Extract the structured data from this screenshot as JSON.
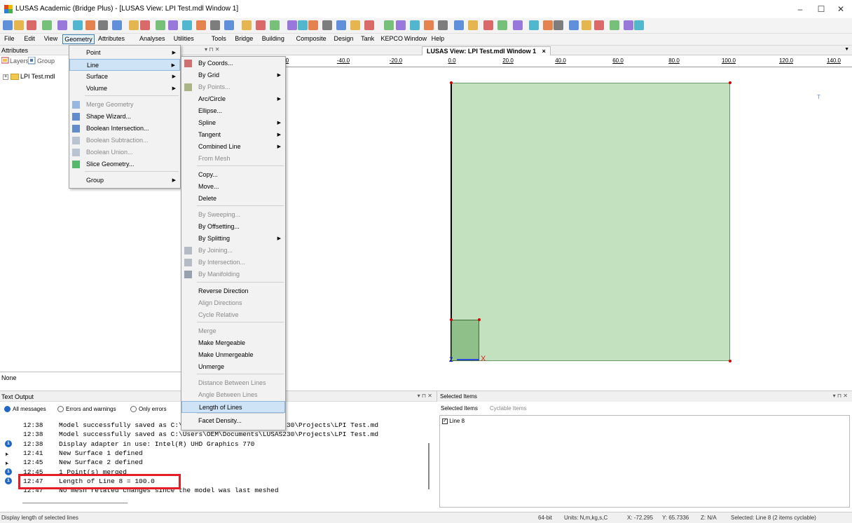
{
  "window": {
    "title": "LUSAS Academic (Bridge Plus) - [LUSAS View: LPI Test.mdl Window 1]",
    "minimize": "–",
    "maximize": "☐",
    "close": "✕"
  },
  "menubar": [
    "File",
    "Edit",
    "View",
    "Geometry",
    "Attributes",
    "Analyses",
    "Utilities",
    "Tools",
    "Bridge",
    "Building",
    "Composite",
    "Design",
    "Tank",
    "KEPCO",
    "Window",
    "Help"
  ],
  "left_panel": {
    "header": "Attributes",
    "tabs": [
      "Layers",
      "Group"
    ],
    "tree_item": "LPI Test.mdl",
    "status": "None"
  },
  "viewport": {
    "tab": "LUSAS View: LPI Test.mdl Window 1",
    "tab_close": "×",
    "pane_controls": "▾ ⊓ ✕",
    "ruler_labels": [
      "0",
      "-40.0",
      "-20.0",
      "0.0",
      "20.0",
      "40.0",
      "60.0",
      "80.0",
      "100.0",
      "120.0",
      "140.0"
    ],
    "triad_label": "T",
    "axis_z": "Z",
    "axis_x": "X"
  },
  "geometry_menu": [
    {
      "label": "Point",
      "submenu": true,
      "disabled": false
    },
    {
      "label": "Line",
      "submenu": true,
      "disabled": false,
      "highlighted": true
    },
    {
      "label": "Surface",
      "submenu": true,
      "disabled": false
    },
    {
      "label": "Volume",
      "submenu": true,
      "disabled": false
    },
    {
      "label": "Merge Geometry",
      "submenu": false,
      "disabled": true
    },
    {
      "label": "Shape Wizard...",
      "submenu": false,
      "disabled": false
    },
    {
      "label": "Boolean Intersection...",
      "submenu": false,
      "disabled": false
    },
    {
      "label": "Boolean Subtraction...",
      "submenu": false,
      "disabled": true
    },
    {
      "label": "Boolean Union...",
      "submenu": false,
      "disabled": true
    },
    {
      "label": "Slice Geometry...",
      "submenu": false,
      "disabled": false
    },
    {
      "label": "Group",
      "submenu": true,
      "disabled": false
    }
  ],
  "line_menu": [
    {
      "label": "By Coords...",
      "submenu": false,
      "disabled": false
    },
    {
      "label": "By Grid",
      "submenu": true,
      "disabled": false
    },
    {
      "label": "By Points...",
      "submenu": false,
      "disabled": true
    },
    {
      "label": "Arc/Circle",
      "submenu": true,
      "disabled": false
    },
    {
      "label": "Ellipse...",
      "submenu": false,
      "disabled": false
    },
    {
      "label": "Spline",
      "submenu": true,
      "disabled": false
    },
    {
      "label": "Tangent",
      "submenu": true,
      "disabled": false
    },
    {
      "label": "Combined Line",
      "submenu": true,
      "disabled": false
    },
    {
      "label": "From Mesh",
      "submenu": false,
      "disabled": true
    },
    {
      "label": "Copy...",
      "submenu": false,
      "disabled": false
    },
    {
      "label": "Move...",
      "submenu": false,
      "disabled": false
    },
    {
      "label": "Delete",
      "submenu": false,
      "disabled": false
    },
    {
      "label": "By Sweeping...",
      "submenu": false,
      "disabled": true
    },
    {
      "label": "By Offsetting...",
      "submenu": false,
      "disabled": false
    },
    {
      "label": "By Splitting",
      "submenu": true,
      "disabled": false
    },
    {
      "label": "By Joining...",
      "submenu": false,
      "disabled": true
    },
    {
      "label": "By Intersection...",
      "submenu": false,
      "disabled": true
    },
    {
      "label": "By Manifolding",
      "submenu": false,
      "disabled": true
    },
    {
      "label": "Reverse Direction",
      "submenu": false,
      "disabled": false
    },
    {
      "label": "Align Directions",
      "submenu": false,
      "disabled": true
    },
    {
      "label": "Cycle Relative",
      "submenu": false,
      "disabled": true
    },
    {
      "label": "Merge",
      "submenu": false,
      "disabled": true
    },
    {
      "label": "Make Mergeable",
      "submenu": false,
      "disabled": false
    },
    {
      "label": "Make Unmergeable",
      "submenu": false,
      "disabled": false
    },
    {
      "label": "Unmerge",
      "submenu": false,
      "disabled": false
    },
    {
      "label": "Distance Between Lines",
      "submenu": false,
      "disabled": true
    },
    {
      "label": "Angle Between Lines",
      "submenu": false,
      "disabled": true
    },
    {
      "label": "Length of Lines",
      "submenu": false,
      "disabled": false,
      "highlighted": true
    },
    {
      "label": "Facet Density...",
      "submenu": false,
      "disabled": false
    }
  ],
  "text_output": {
    "header": "Text Output",
    "pane_controls": "▾ ⊓ ✕",
    "filters": [
      "All messages",
      "Errors and warnings",
      "Only errors"
    ],
    "lines": [
      {
        "time": "12:38",
        "text": "Model successfully saved as C:\\Users\\OEM\\Documents\\LUSAS230\\Projects\\LPI Test.md",
        "icon": ""
      },
      {
        "time": "12:38",
        "text": "Model successfully saved as C:\\Users\\OEM\\Documents\\LUSAS230\\Projects\\LPI Test.md",
        "icon": ""
      },
      {
        "time": "12:38",
        "text": "Display adapter in use: Intel(R) UHD Graphics 770",
        "icon": "info"
      },
      {
        "time": "12:41",
        "text": "New Surface 1 defined",
        "icon": "cursor"
      },
      {
        "time": "12:45",
        "text": "New Surface 2 defined",
        "icon": "cursor"
      },
      {
        "time": "12:45",
        "text": "1 Point(s) merged",
        "icon": "info"
      },
      {
        "time": "12:47",
        "text": "Length of Line 8 = 100.0",
        "icon": "info"
      },
      {
        "time": "12:47",
        "text": "No mesh related changes since the model was last meshed",
        "icon": ""
      }
    ]
  },
  "selected_items": {
    "header": "Selected Items",
    "pane_controls": "▾ ⊓ ✕",
    "tabs": [
      "Selected Items",
      "Cyclable Items"
    ],
    "items": [
      "Line 8"
    ]
  },
  "statusbar": {
    "hint": "Display length of selected lines",
    "bits": "64-bit",
    "units": "Units: N,m,kg,s,C",
    "x": "X: -72.295",
    "y": "Y: 65.7336",
    "z": "Z: N/A",
    "selected": "Selected: Line 8 (2 items cyclable)"
  },
  "colors": {
    "surface_fill": "#c3e0bf",
    "small_surface_fill": "#8fc089",
    "highlight_box": "#e41e26",
    "point": "#d40000"
  }
}
